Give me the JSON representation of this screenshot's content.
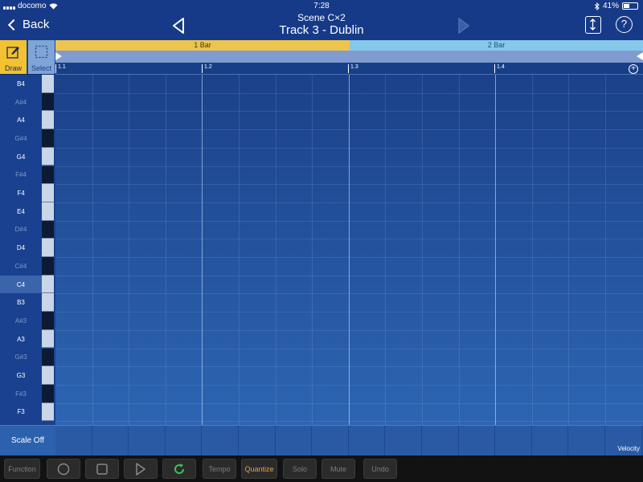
{
  "status_bar": {
    "carrier": "docomo",
    "time": "7:28",
    "battery": "41%",
    "battery_fraction": 0.41
  },
  "nav": {
    "back_label": "Back",
    "scene": "Scene  C×2",
    "track": "Track 3 - Dublin",
    "help": "?"
  },
  "tools": {
    "draw_label": "Draw",
    "select_label": "Select"
  },
  "bars": [
    "1 Bar",
    "2 Bar"
  ],
  "beats": [
    "1.1",
    "1.2",
    "1.3",
    "1.4"
  ],
  "ruler_add": "+",
  "keys": [
    {
      "label": "B4",
      "type": "natural"
    },
    {
      "label": "A#4",
      "type": "sharp"
    },
    {
      "label": "A4",
      "type": "natural"
    },
    {
      "label": "G#4",
      "type": "sharp"
    },
    {
      "label": "G4",
      "type": "natural"
    },
    {
      "label": "F#4",
      "type": "sharp"
    },
    {
      "label": "F4",
      "type": "natural"
    },
    {
      "label": "E4",
      "type": "natural"
    },
    {
      "label": "D#4",
      "type": "sharp"
    },
    {
      "label": "D4",
      "type": "natural"
    },
    {
      "label": "C#4",
      "type": "sharp"
    },
    {
      "label": "C4",
      "type": "natural"
    },
    {
      "label": "B3",
      "type": "natural"
    },
    {
      "label": "A#3",
      "type": "sharp"
    },
    {
      "label": "A3",
      "type": "natural"
    },
    {
      "label": "G#3",
      "type": "sharp"
    },
    {
      "label": "G3",
      "type": "natural"
    },
    {
      "label": "F#3",
      "type": "sharp"
    },
    {
      "label": "F3",
      "type": "natural"
    }
  ],
  "scale_button": "Scale Off",
  "velocity_label": "Velocity",
  "toolbar": {
    "function": "Function",
    "tempo": "Tempo",
    "quantize": "Quantize",
    "solo": "Solo",
    "mute": "Mute",
    "undo": "Undo"
  },
  "colors": {
    "draw_tool": "#f2c230",
    "select_tool": "#7fa4d6",
    "bar1": "#ecc44e",
    "bar2": "#86c8ea",
    "quantize_text": "#e9a23a",
    "loop_icon": "#37c451"
  }
}
